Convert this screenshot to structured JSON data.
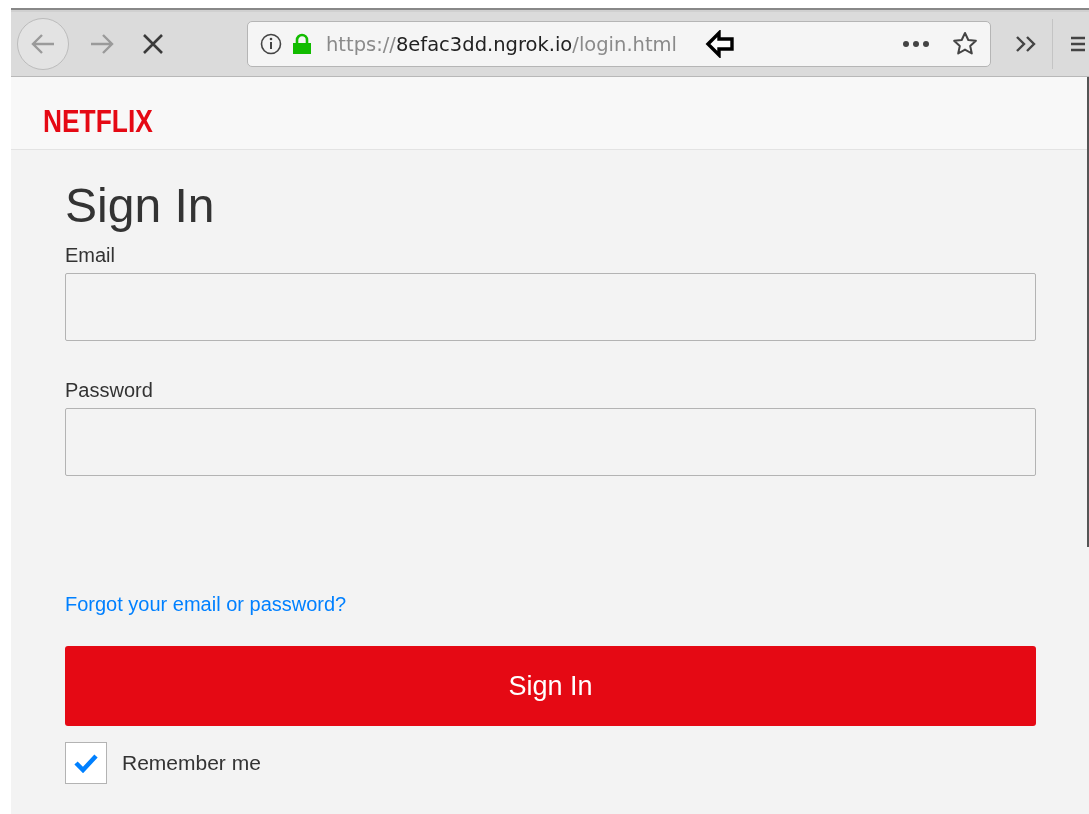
{
  "browser": {
    "url": {
      "scheme": "https://",
      "host": "8efac3dd.ngrok.io",
      "path": "/login.html"
    },
    "secure": true,
    "loading": true
  },
  "page": {
    "logo": "NETFLIX",
    "heading": "Sign In",
    "fields": [
      {
        "label": "Email"
      },
      {
        "label": "Password"
      }
    ],
    "forgot_link": "Forgot your email or password?",
    "submit_button": "Sign In",
    "remember": {
      "label": "Remember me",
      "checked": true
    }
  }
}
